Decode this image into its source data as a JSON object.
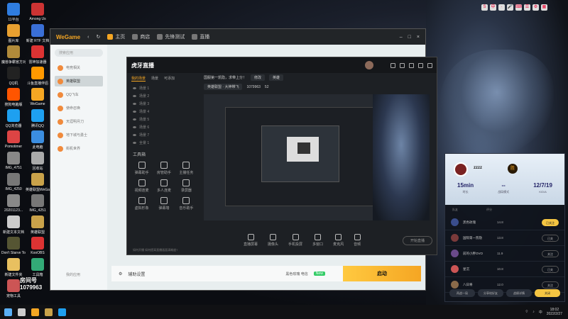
{
  "desktop": {
    "icons": [
      {
        "label": "11平台",
        "color": "#2f7de1"
      },
      {
        "label": "Among Us",
        "color": "#c33"
      },
      {
        "label": "图片库",
        "color": "#e8a030"
      },
      {
        "label": "新建 RTF 文档",
        "color": "#3a6fd6"
      },
      {
        "label": "魔兽争霸官方对战平台",
        "color": "#b08a3a"
      },
      {
        "label": "雷神加速器",
        "color": "#d33"
      },
      {
        "label": "QQ机",
        "color": "#222"
      },
      {
        "label": "斗鱼直播伴侣",
        "color": "#f90"
      },
      {
        "label": "搜狗电脑版",
        "color": "#f50"
      },
      {
        "label": "WeGame",
        "color": "#f5a623"
      },
      {
        "label": "QQ浏览器",
        "color": "#1ea0f0"
      },
      {
        "label": "腾讯QQ",
        "color": "#1ea0f0"
      },
      {
        "label": "Pomotimer",
        "color": "#d44"
      },
      {
        "label": "此电脑",
        "color": "#3b8de0"
      },
      {
        "label": "IMG_4751",
        "color": "#888"
      },
      {
        "label": "回收站",
        "color": "#aaa"
      },
      {
        "label": "IMG_4250",
        "color": "#777"
      },
      {
        "label": "英雄联盟WeGame版",
        "color": "#c9a24a"
      },
      {
        "label": "20201123...",
        "color": "#888"
      },
      {
        "label": "IMG_4251",
        "color": "#777"
      },
      {
        "label": "新建文本文档",
        "color": "#ccc"
      },
      {
        "label": "英雄联盟",
        "color": "#c9a24a"
      },
      {
        "label": "Don't Starve Together",
        "color": "#553"
      },
      {
        "label": "KooOBS",
        "color": "#d33"
      },
      {
        "label": "新建文件夹",
        "color": "#e8c060"
      },
      {
        "label": "工具箱",
        "color": "#3a7"
      },
      {
        "label": "宠物工具",
        "color": "#c55"
      }
    ]
  },
  "toptray": [
    "S",
    "中",
    "·",
    "🎤",
    "⌨",
    "☰",
    "⚙",
    "▦"
  ],
  "wegame": {
    "logo": "WeGame",
    "tabs": [
      "主页",
      "商店",
      "先锋测试",
      "直播"
    ],
    "search_placeholder": "搜索应用",
    "side_items": [
      "电竞相关",
      "英雄联盟",
      "QQ飞车",
      "使命召唤",
      "天涯明月刀",
      "地下城与勇士",
      "街机世界"
    ],
    "active_item": "英雄联盟",
    "manage": "我的应用",
    "assist": "辅助设置",
    "server": "黑色玫瑰 电信",
    "server_badge": "New",
    "launch": "启动"
  },
  "huya": {
    "logo": "虎牙直播",
    "tabs": [
      "我的场景",
      "场景",
      "可添加"
    ],
    "scenes": [
      "场景 1",
      "场景 2",
      "场景 3",
      "场景 4",
      "场景 5",
      "场景 6",
      "场景 7"
    ],
    "all_scenes": "全景 1",
    "tools_title": "工具箱",
    "tools": [
      "弹幕助手",
      "房管助手",
      "主播任务",
      "视频连麦",
      "多人连麦",
      "录屏器",
      "虚拟形象",
      "弹幕墙",
      "音乐助手"
    ],
    "hint": "如何开播 如何提高直播画面清晰度?",
    "title_text": "国服第一凯隐，求带上分！",
    "title_btn": "修改",
    "category": "英雄",
    "room_prefix": "英雄联盟 · 大神带飞",
    "room_id": "1079963",
    "fans": "52",
    "bottom": [
      "直播屏幕",
      "摄像头",
      "手机投屏",
      "多窗口",
      "麦克风",
      "音频"
    ],
    "start": "开始直播"
  },
  "panel": {
    "player": "zzzz",
    "badge": "胜",
    "stats": [
      {
        "value": "15min",
        "label": "时长"
      },
      {
        "value": "--",
        "label": "战局模式"
      },
      {
        "value": "12/7/19",
        "label": "K/D/A"
      }
    ],
    "col_left": "队友",
    "col_right": "评分",
    "rows": [
      {
        "name": "黑色玫瑰",
        "score": "14.8",
        "btn": "已关注",
        "gold": true,
        "color": "#3a4d8c"
      },
      {
        "name": "国际第一凯隐",
        "score": "13.8",
        "btn": "已关",
        "gold": false,
        "color": "#7a3a3a"
      },
      {
        "name": "前的小胖OVO",
        "score": "11.9",
        "btn": "关注",
        "gold": false,
        "color": "#6a4a8a"
      },
      {
        "name": "星沉",
        "score": "10.8",
        "btn": "已关",
        "gold": false,
        "color": "#c55"
      },
      {
        "name": "八日将",
        "score": "12.0",
        "btn": "关注",
        "gold": false,
        "color": "#8a6a4a"
      }
    ],
    "footer": [
      "再战一局",
      "分享给好友",
      "战绩详情",
      "关闭"
    ]
  },
  "overlay": {
    "line1": "房间号",
    "line2": "1079963"
  },
  "taskbar": {
    "icons": [
      {
        "name": "windows-icon",
        "color": "#5aaff5"
      },
      {
        "name": "search-icon",
        "color": "#ccc"
      },
      {
        "name": "wegame-icon",
        "color": "#f5a623"
      },
      {
        "name": "lol-icon",
        "color": "#c9a24a"
      },
      {
        "name": "browser-icon",
        "color": "#1ea0f0"
      }
    ],
    "time": "18:02",
    "date": "2022/2/27",
    "ime": "中"
  }
}
